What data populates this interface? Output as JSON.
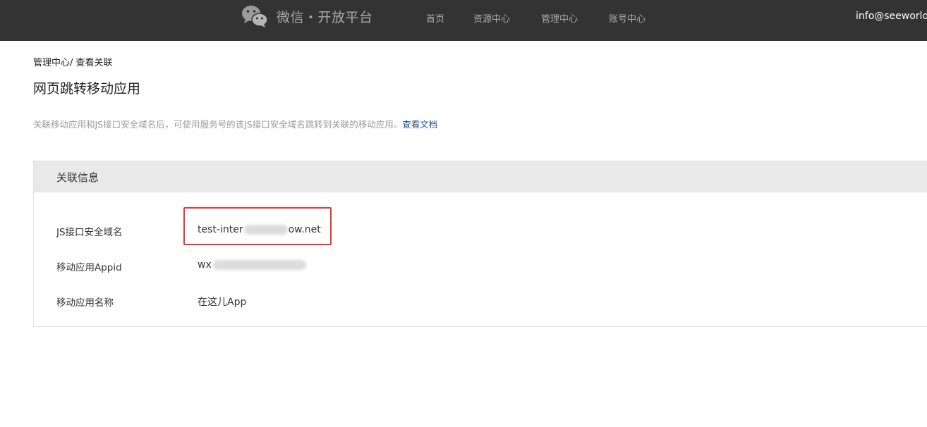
{
  "header": {
    "brand": "微信・开放平台",
    "nav": [
      {
        "label": "首页"
      },
      {
        "label": "资源中心"
      },
      {
        "label": "管理中心"
      },
      {
        "label": "账号中心"
      }
    ],
    "user_email": "info@seeworld"
  },
  "breadcrumb": {
    "parent": "管理中心",
    "separator": "/ ",
    "current": "查看关联"
  },
  "page_title": "网页跳转移动应用",
  "description": {
    "text": "关联移动应用和JS接口安全域名后，可使用服务号的该JS接口安全域名跳转到关联的移动应用。",
    "link": "查看文档"
  },
  "panel": {
    "title": "关联信息",
    "rows": [
      {
        "label": "JS接口安全域名",
        "value_prefix": "test-inter",
        "value_suffix": "ow.net"
      },
      {
        "label": "移动应用Appid",
        "value_prefix": "wx"
      },
      {
        "label": "移动应用名称",
        "value": "在这儿App"
      }
    ]
  },
  "colors": {
    "topbar_bg": "#333333",
    "nav_text": "#a9a9a9",
    "panel_header_bg": "#e9e9e9",
    "link": "#2f4f86",
    "highlight": "#e53935"
  }
}
